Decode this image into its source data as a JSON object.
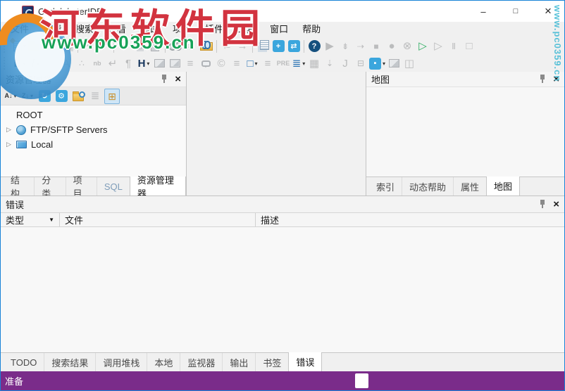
{
  "window": {
    "title": "CodelobsterIDE",
    "controls": {
      "minimize": "–",
      "maximize": "□",
      "close": "×"
    }
  },
  "watermark": {
    "title": "河东软件园",
    "url": "www.pc0359.cn",
    "side_url": "www.pc0359.cn",
    "red": "#d2333f",
    "green": "#17a258",
    "teal": "#49bdd6"
  },
  "menu": {
    "items": [
      "文件",
      "编辑",
      "搜索",
      "查看",
      "调试",
      "项目",
      "插件",
      "工具",
      "窗口",
      "帮助"
    ]
  },
  "toolbar_main": [
    {
      "grip": true
    },
    {
      "n": "new-file-button",
      "shape": "doc",
      "dd": true
    },
    {
      "n": "open-file-button",
      "shape": "folder",
      "dd": true
    },
    {
      "n": "save-button",
      "shape": "disk"
    },
    {
      "n": "save-all-button",
      "shape": "disk2"
    },
    {
      "sep": true
    },
    {
      "n": "undo-button",
      "g": "↶",
      "c": "dis big"
    },
    {
      "n": "redo-button",
      "g": "↷",
      "c": "dis big"
    },
    {
      "sep": true
    },
    {
      "n": "cut-button",
      "g": "✂",
      "c": "dis big"
    },
    {
      "n": "copy-button",
      "shape": "copy"
    },
    {
      "n": "paste-button",
      "shape": "paste"
    },
    {
      "sep": true
    },
    {
      "n": "find-button",
      "shape": "bino"
    },
    {
      "n": "replace-button",
      "g": "ab",
      "c": "dis tiny"
    },
    {
      "n": "find-in-files-button",
      "shape": "binoc"
    },
    {
      "sep": true
    },
    {
      "n": "navigate-back-button",
      "g": "←",
      "c": "dis big"
    },
    {
      "n": "navigate-forward-button",
      "g": "→",
      "c": "dis big"
    },
    {
      "sep": true
    },
    {
      "n": "compare-files-button",
      "shape": "doc2"
    },
    {
      "n": "sitemap-button",
      "tile": "cyan",
      "g": "+"
    },
    {
      "n": "sync-files-button",
      "tile": "cyan",
      "g": "⇄"
    },
    {
      "sep": true
    },
    {
      "n": "help-button",
      "tile": "dark",
      "g": "?"
    },
    {
      "n": "run-script-button",
      "g": "▶",
      "c": "dis big"
    },
    {
      "n": "step-into-button",
      "g": "⇟",
      "c": "dis"
    },
    {
      "n": "step-over-button",
      "g": "⇢",
      "c": "dis"
    },
    {
      "n": "stop-script-button",
      "g": "■",
      "c": "dis"
    },
    {
      "n": "breakpoint-button",
      "g": "●",
      "c": "dis big"
    },
    {
      "n": "remove-breakpoints-button",
      "g": "⊗",
      "c": "dis big"
    },
    {
      "n": "start-debug-button",
      "g": "▷",
      "c": "green big"
    },
    {
      "n": "continue-debug-button",
      "g": "▷",
      "c": "dis big"
    },
    {
      "n": "pause-debug-button",
      "g": "Ⅱ",
      "c": "dis"
    },
    {
      "n": "stop-debug-button",
      "g": "□",
      "c": "dis big"
    }
  ],
  "toolbar_format": [
    {
      "grip": true
    },
    {
      "n": "bold-button",
      "g": "B",
      "c": "b-blue",
      "dd": true
    },
    {
      "n": "italic-button",
      "g": "I",
      "c": "i-it",
      "dd": true
    },
    {
      "n": "underline-button",
      "g": "U",
      "c": "dis und big"
    },
    {
      "n": "font-button",
      "g": "A",
      "c": "dis big"
    },
    {
      "n": "special-char-button",
      "g": "∴",
      "c": "dis"
    },
    {
      "n": "nbsp-button",
      "g": "nb",
      "c": "dis tiny"
    },
    {
      "n": "line-break-button",
      "g": "↵",
      "c": "dis big"
    },
    {
      "n": "paragraph-button",
      "g": "¶",
      "c": "dis big"
    },
    {
      "n": "heading-button",
      "g": "H",
      "c": "b-blue",
      "dd": true
    },
    {
      "n": "image-button",
      "shape": "pic"
    },
    {
      "n": "image-map-button",
      "shape": "pic2"
    },
    {
      "n": "align-left-button",
      "g": "≡",
      "c": "dis big"
    },
    {
      "n": "comment-button",
      "shape": "bubble"
    },
    {
      "n": "copyright-button",
      "g": "©",
      "c": "dis big"
    },
    {
      "n": "align-center-button",
      "g": "≡",
      "c": "dis big"
    },
    {
      "n": "div-container-button",
      "g": "□",
      "c": "blue big",
      "dd": true
    },
    {
      "n": "align-justify-button",
      "g": "≡",
      "c": "dis big"
    },
    {
      "n": "pre-button",
      "g": "PRE",
      "c": "dis tiny"
    },
    {
      "n": "list-button",
      "g": "≣",
      "c": "blue big",
      "dd": true
    },
    {
      "n": "table-button",
      "g": "▦",
      "c": "dis big"
    },
    {
      "n": "indent-button",
      "g": "⇣",
      "c": "dis"
    },
    {
      "n": "jquery-button",
      "g": "J",
      "c": "dis big"
    },
    {
      "n": "field-button",
      "g": "⊟",
      "c": "dis"
    },
    {
      "n": "form-element-button",
      "tile": "cyan",
      "g": "▪",
      "dd": true
    },
    {
      "n": "picture-button",
      "shape": "pic"
    },
    {
      "n": "frames-button",
      "g": "◫",
      "c": "dis big"
    }
  ],
  "explorer": {
    "title": "资源管理器",
    "toolbar": [
      {
        "n": "sort-az-button",
        "g": "A↓",
        "c": "dark tiny",
        "dd": true
      },
      {
        "n": "sort-za-button",
        "g": "Z↓",
        "c": "dark tiny",
        "dd": true
      },
      {
        "n": "refresh-button",
        "tile": "cyan",
        "g": "↻"
      },
      {
        "n": "settings-button",
        "tile": "cyan",
        "g": "⚙"
      },
      {
        "n": "find-folder-button",
        "shape": "folderq"
      },
      {
        "n": "details-view-button",
        "g": "≣",
        "c": "dis big"
      },
      {
        "n": "tree-view-button",
        "g": "⊞",
        "c": "amber",
        "active": true
      }
    ],
    "tree": [
      {
        "label": "ROOT",
        "icon": null,
        "expander": false
      },
      {
        "label": "FTP/SFTP Servers",
        "icon": "globe",
        "expander": true
      },
      {
        "label": "Local",
        "icon": "screen",
        "expander": true
      }
    ],
    "tabs": [
      {
        "label": "结构"
      },
      {
        "label": "分类"
      },
      {
        "label": "项目"
      },
      {
        "label": "SQL",
        "sql": true
      },
      {
        "label": "资源管理器",
        "active": true
      }
    ]
  },
  "map": {
    "title": "地图",
    "tabs": [
      {
        "label": "索引"
      },
      {
        "label": "动态帮助"
      },
      {
        "label": "属性"
      },
      {
        "label": "地图",
        "active": true
      }
    ]
  },
  "errors": {
    "title": "错误",
    "columns": [
      {
        "label": "类型",
        "filter": true
      },
      {
        "label": "文件"
      },
      {
        "label": "描述"
      }
    ],
    "rows": [],
    "tabs": [
      {
        "label": "TODO"
      },
      {
        "label": "搜索结果"
      },
      {
        "label": "调用堆栈"
      },
      {
        "label": "本地"
      },
      {
        "label": "监视器"
      },
      {
        "label": "输出"
      },
      {
        "label": "书签"
      },
      {
        "label": "错误",
        "active": true
      }
    ]
  },
  "statusbar": {
    "text": "准备"
  }
}
